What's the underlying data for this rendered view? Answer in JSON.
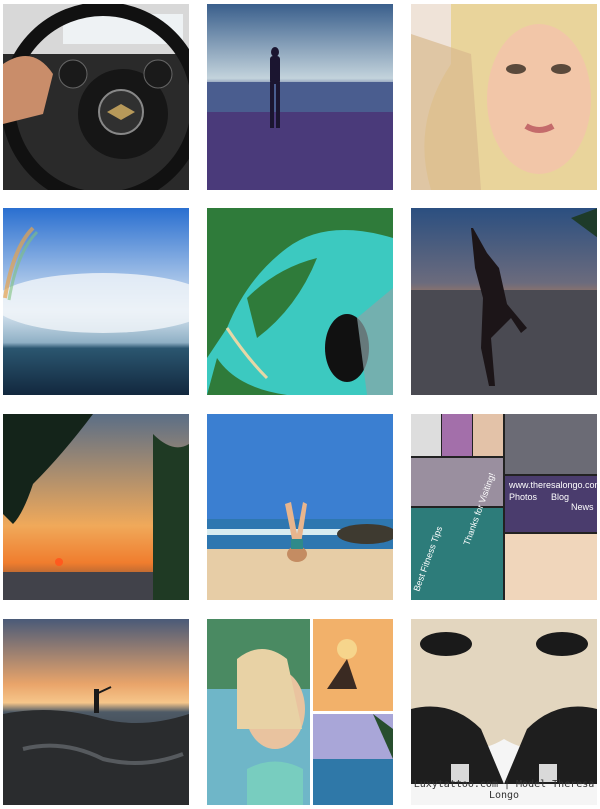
{
  "feed": {
    "tiles": [
      {
        "id": "car-interior",
        "label": "Car steering wheel photo"
      },
      {
        "id": "beach-silhouette",
        "label": "Beach silhouette photo"
      },
      {
        "id": "portrait-closeup",
        "label": "Portrait close-up photo"
      },
      {
        "id": "waterfall-rainbow",
        "label": "Waterfall rainbow photo"
      },
      {
        "id": "aerial-coast",
        "label": "Aerial coastline photo"
      },
      {
        "id": "sunset-pose",
        "label": "Sunset pose photo"
      },
      {
        "id": "palm-sunset",
        "label": "Palm sunset photo"
      },
      {
        "id": "headstand-beach",
        "label": "Beach headstand photo"
      },
      {
        "id": "website-collage",
        "label": "Website promo collage"
      },
      {
        "id": "rocky-sunset",
        "label": "Rocky shore sunset photo"
      },
      {
        "id": "bikini-collage",
        "label": "Bikini collage photo"
      },
      {
        "id": "mirror-portrait",
        "label": "Mirrored portrait photo"
      }
    ],
    "collage": {
      "site": "www.theresalongo.com",
      "nav": [
        "Photos",
        "Blog",
        "News"
      ],
      "tips": "Best Fitness Tips",
      "thanks": "Thanks for Visiting!"
    },
    "mirror_caption": "Luxytattoo.com | Model Theresa Longo"
  },
  "colors": {
    "background": "#ffffff",
    "sunset_orange": "#f08a3c",
    "ocean_blue": "#1f4f86",
    "sky_blue": "#3b7fd1",
    "aqua": "#3cc9c0"
  }
}
